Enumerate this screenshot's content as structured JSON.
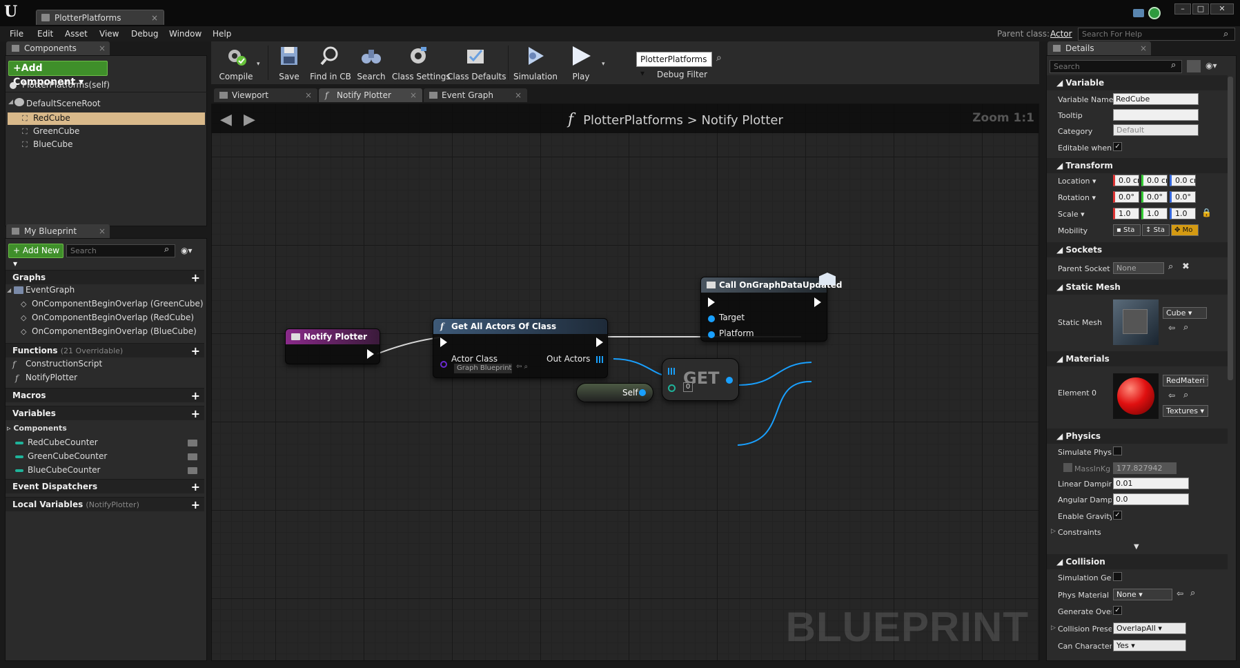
{
  "window": {
    "doc_tab": "PlotterPlatforms",
    "buttons": {
      "minimize": "–",
      "maximize": "□",
      "close": "✕"
    }
  },
  "menu": {
    "items": [
      "File",
      "Edit",
      "Asset",
      "View",
      "Debug",
      "Window",
      "Help"
    ],
    "parent_class_label": "Parent class:",
    "parent_class_value": "Actor",
    "help_search_placeholder": "Search For Help"
  },
  "components_panel": {
    "tab": "Components",
    "add_button": "+Add Component ▾",
    "self_item": "PlotterPlatforms(self)",
    "root": "DefaultSceneRoot",
    "children": [
      "RedCube",
      "GreenCube",
      "BlueCube"
    ]
  },
  "my_blueprint": {
    "tab": "My Blueprint",
    "add_new": "+ Add New ▾",
    "search_placeholder": "Search",
    "graphs_header": "Graphs",
    "event_graph": "EventGraph",
    "events": [
      "OnComponentBeginOverlap (GreenCube)",
      "OnComponentBeginOverlap (RedCube)",
      "OnComponentBeginOverlap (BlueCube)"
    ],
    "functions_header": "Functions",
    "functions_sub": "(21 Overridable)",
    "functions": [
      "ConstructionScript",
      "NotifyPlotter"
    ],
    "macros_header": "Macros",
    "variables_header": "Variables",
    "components_header": "Components",
    "variables": [
      "RedCubeCounter",
      "GreenCubeCounter",
      "BlueCubeCounter"
    ],
    "dispatchers_header": "Event Dispatchers",
    "local_vars_header": "Local Variables",
    "local_vars_sub": "(NotifyPlotter)"
  },
  "toolbar": {
    "buttons": [
      "Compile",
      "Save",
      "Find in CB",
      "Search",
      "Class Settings",
      "Class Defaults",
      "Simulation",
      "Play"
    ],
    "debug_filter_value": "PlotterPlatforms ▾",
    "debug_filter_label": "Debug Filter"
  },
  "graph_tabs": [
    "Viewport",
    "Notify Plotter",
    "Event Graph"
  ],
  "graph": {
    "breadcrumb_root": "PlotterPlatforms",
    "breadcrumb_sep": ">",
    "breadcrumb_current": "Notify Plotter",
    "zoom": "Zoom 1:1",
    "watermark": "BLUEPRINT",
    "nodes": {
      "notify": {
        "title": "Notify Plotter"
      },
      "get_all": {
        "title": "Get All Actors Of Class",
        "actor_class": "Actor Class",
        "class_value": "Graph Blueprint ▾",
        "out_actors": "Out Actors"
      },
      "get": {
        "title": "GET",
        "index": "0"
      },
      "self": {
        "title": "Self"
      },
      "call": {
        "title": "Call OnGraphDataUpdated",
        "target": "Target",
        "platform": "Platform"
      }
    }
  },
  "details": {
    "tab": "Details",
    "search_placeholder": "Search",
    "variable_header": "Variable",
    "variable_name_label": "Variable Name",
    "variable_name_value": "RedCube",
    "tooltip_label": "Tooltip",
    "category_label": "Category",
    "category_value": "Default",
    "editable_label": "Editable when",
    "transform_header": "Transform",
    "location_label": "Location ▾",
    "location_values": [
      "0.0 cm",
      "0.0 cm",
      "0.0 cm"
    ],
    "rotation_label": "Rotation ▾",
    "rotation_values": [
      "0.0°",
      "0.0°",
      "0.0°"
    ],
    "scale_label": "Scale ▾",
    "scale_values": [
      "1.0",
      "1.0",
      "1.0"
    ],
    "mobility_label": "Mobility",
    "mobility_options": [
      "Sta",
      "Sta",
      "Mo"
    ],
    "sockets_header": "Sockets",
    "parent_socket_label": "Parent Socket",
    "parent_socket_value": "None",
    "static_mesh_header": "Static Mesh",
    "static_mesh_label": "Static Mesh",
    "static_mesh_value": "Cube ▾",
    "materials_header": "Materials",
    "element0_label": "Element 0",
    "material_value": "RedMateri ▾",
    "textures_value": "Textures ▾",
    "physics_header": "Physics",
    "simulate_physics_label": "Simulate Phys",
    "mass_label": "MassInKg",
    "mass_value": "177.827942",
    "linear_damping_label": "Linear Dampin",
    "linear_damping_value": "0.01",
    "angular_damping_label": "Angular Damp",
    "angular_damping_value": "0.0",
    "gravity_label": "Enable Gravity",
    "constraints_label": "Constraints",
    "collision_header": "Collision",
    "sim_gen_label": "Simulation Ge",
    "phys_material_label": "Phys Material",
    "phys_material_value": "None ▾",
    "gen_overlap_label": "Generate Over",
    "collision_preset_label": "Collision Prese",
    "collision_preset_value": "OverlapAll ▾",
    "can_character_label": "Can Character",
    "can_character_value": "Yes ▾"
  },
  "colors": {
    "selected_row": "#d9b98a",
    "function_header": "#3e5a78",
    "notify_header": "#8a2a8a",
    "call_header": "#3c4650",
    "green_button": "#3f8f2a",
    "object_pin": "#19a0ff"
  }
}
